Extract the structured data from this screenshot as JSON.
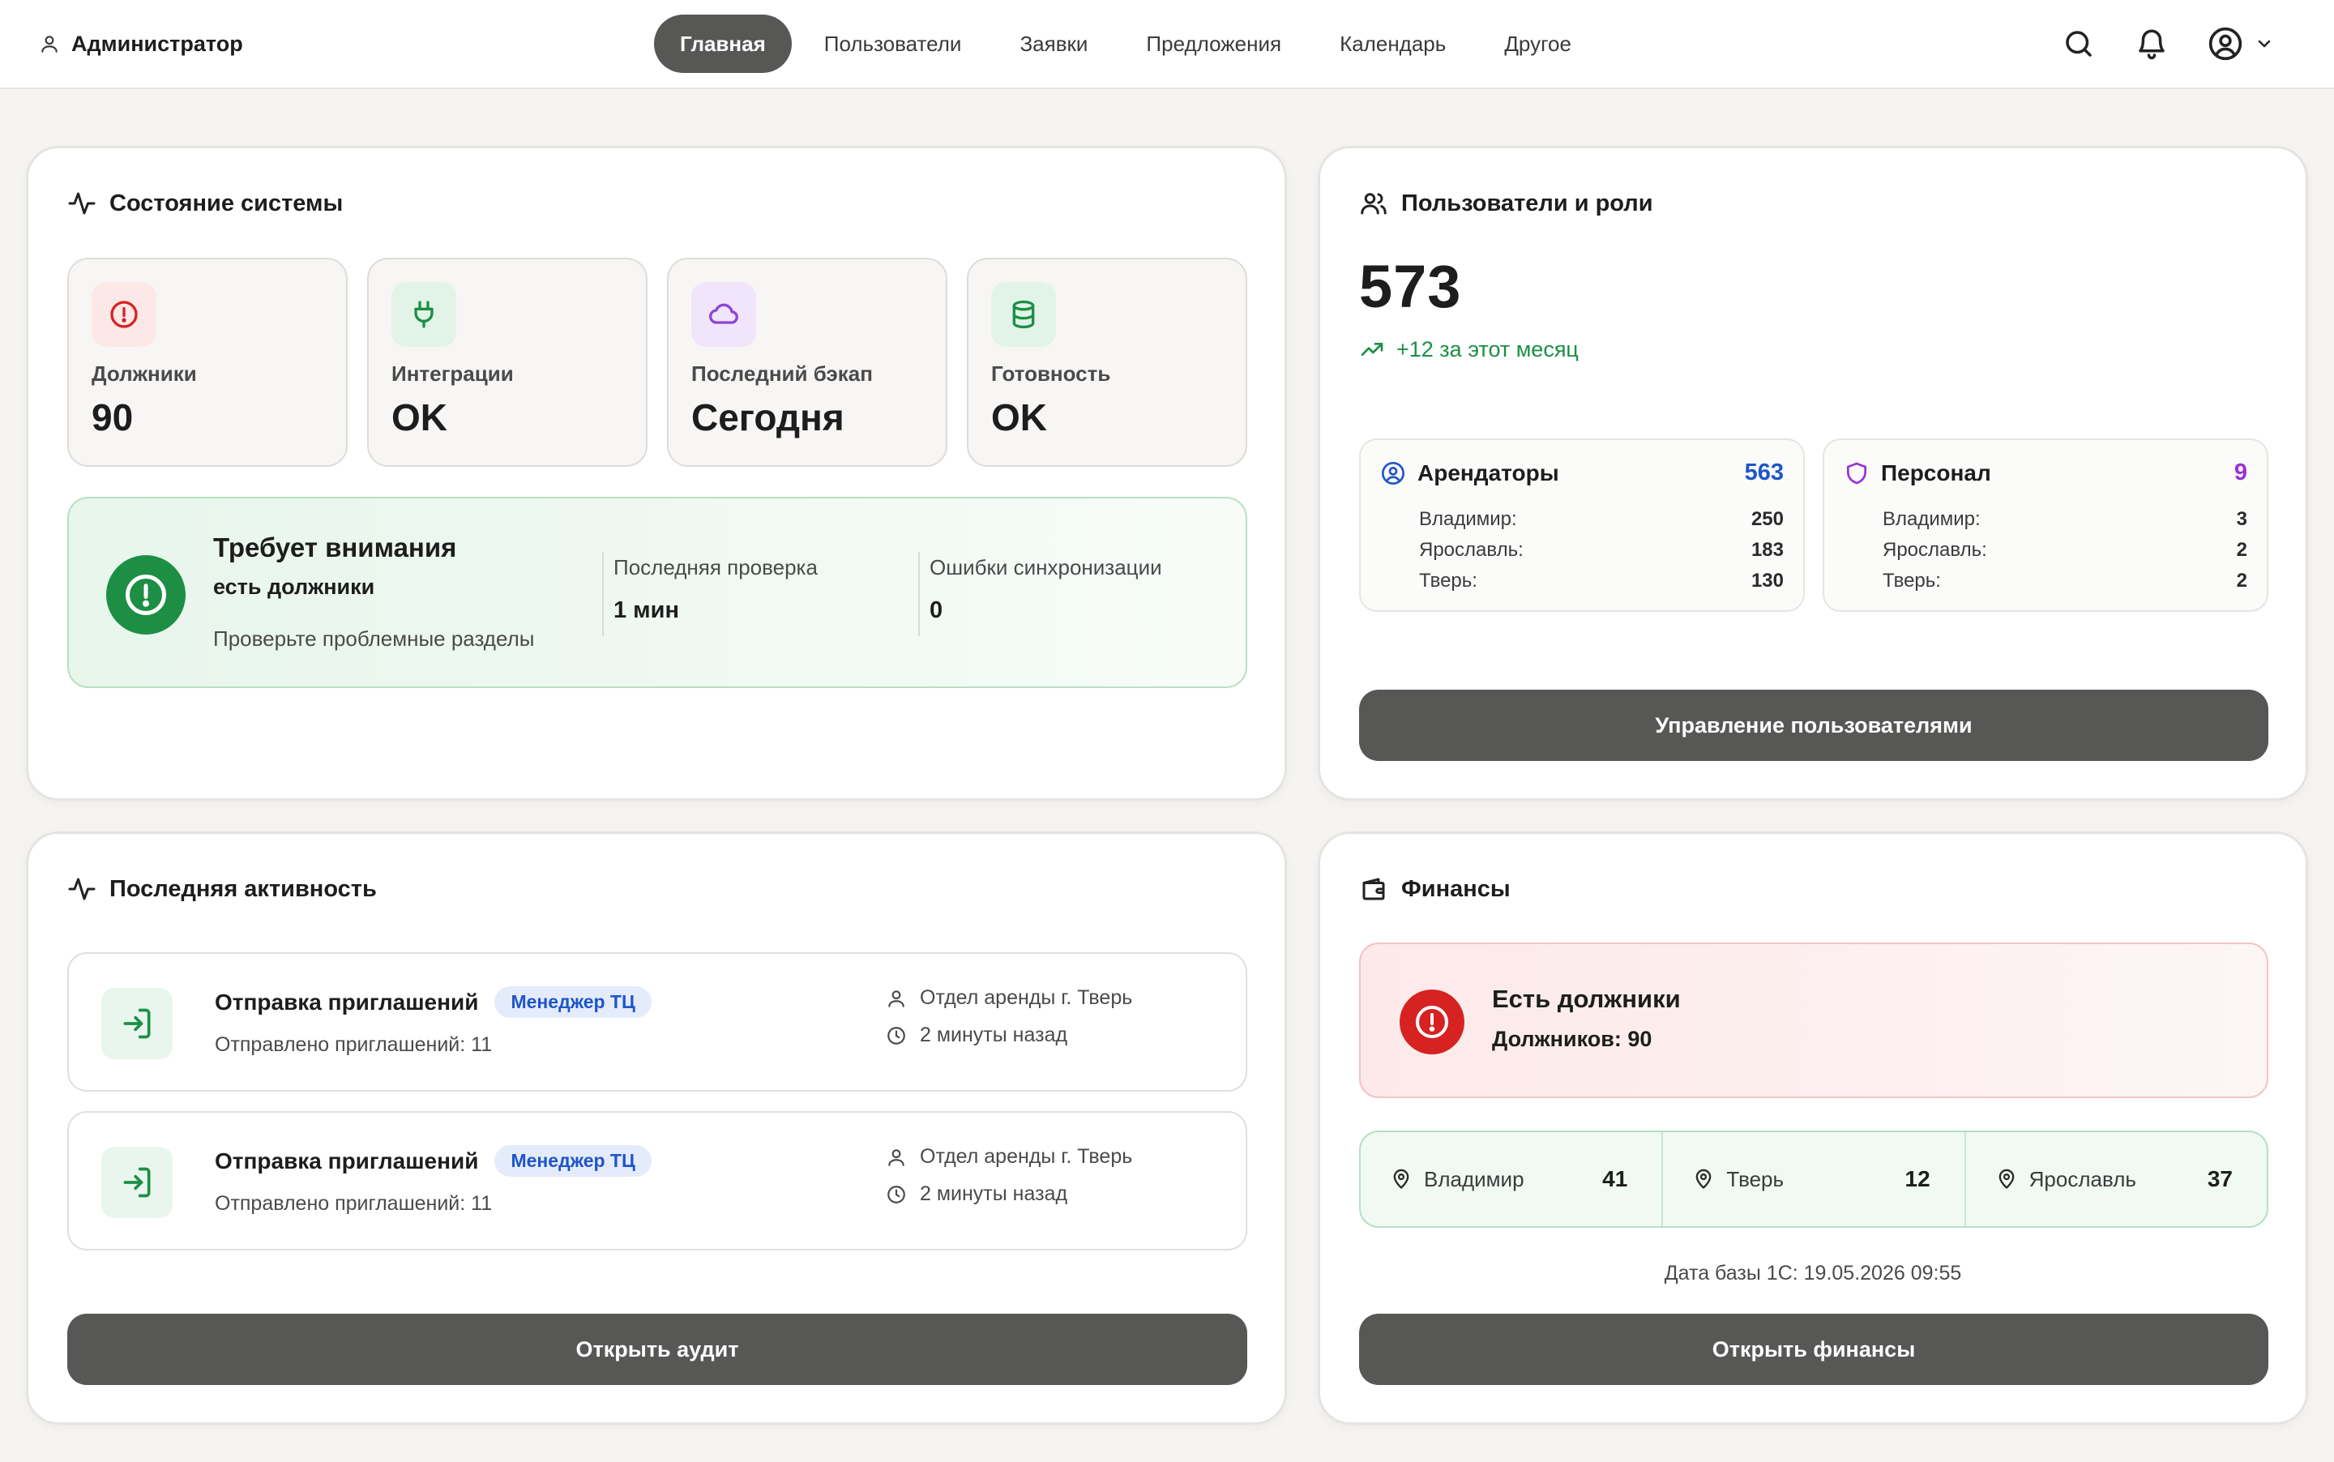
{
  "header": {
    "user_label": "Администратор",
    "nav": [
      {
        "label": "Главная",
        "active": true
      },
      {
        "label": "Пользователи"
      },
      {
        "label": "Заявки"
      },
      {
        "label": "Предложения"
      },
      {
        "label": "Календарь"
      },
      {
        "label": "Другое"
      }
    ],
    "icons": [
      "search-icon",
      "bell-icon",
      "user-circle-icon",
      "chevron-down-icon"
    ]
  },
  "system": {
    "title": "Состояние системы",
    "tiles": [
      {
        "label": "Должники",
        "value": "90",
        "icon": "alert-circle-icon",
        "color": "#d72222"
      },
      {
        "label": "Интеграции",
        "value": "OK",
        "icon": "plug-icon",
        "color": "#1c8f45"
      },
      {
        "label": "Последний бэкап",
        "value": "Сегодня",
        "icon": "cloud-icon",
        "color": "#8e44d6"
      },
      {
        "label": "Готовность",
        "value": "OK",
        "icon": "database-icon",
        "color": "#1c8f45"
      }
    ],
    "attention": {
      "title": "Требует внимания",
      "subtitle": "есть должники",
      "note": "Проверьте проблемные разделы",
      "last_check_label": "Последняя проверка",
      "last_check_value": "1 мин",
      "sync_errors_label": "Ошибки синхронизации",
      "sync_errors_value": "0"
    }
  },
  "users": {
    "title": "Пользователи и роли",
    "total": "573",
    "growth": "+12 за этот месяц",
    "roles": [
      {
        "name": "Арендаторы",
        "count": "563",
        "color": "#1f55c9",
        "icon": "user-circle-icon",
        "rows": [
          {
            "city": "Владимир:",
            "value": "250"
          },
          {
            "city": "Ярославль:",
            "value": "183"
          },
          {
            "city": "Тверь:",
            "value": "130"
          }
        ]
      },
      {
        "name": "Персонал",
        "count": "9",
        "color": "#9b2fd6",
        "icon": "shield-icon",
        "rows": [
          {
            "city": "Владимир:",
            "value": "3"
          },
          {
            "city": "Ярославль:",
            "value": "2"
          },
          {
            "city": "Тверь:",
            "value": "2"
          }
        ]
      }
    ],
    "button": "Управление пользователями"
  },
  "activity": {
    "title": "Последняя активность",
    "items": [
      {
        "title": "Отправка приглашений",
        "badge": "Менеджер ТЦ",
        "subtitle": "Отправлено приглашений: 11",
        "dept": "Отдел аренды г. Тверь",
        "time": "2 минуты назад"
      },
      {
        "title": "Отправка приглашений",
        "badge": "Менеджер ТЦ",
        "subtitle": "Отправлено приглашений: 11",
        "dept": "Отдел аренды г. Тверь",
        "time": "2 минуты назад"
      }
    ],
    "button": "Открыть аудит"
  },
  "finance": {
    "title": "Финансы",
    "alert_title": "Есть должники",
    "alert_sub": "Должников: 90",
    "cities": [
      {
        "name": "Владимир",
        "value": "41"
      },
      {
        "name": "Тверь",
        "value": "12"
      },
      {
        "name": "Ярославль",
        "value": "37"
      }
    ],
    "db_date": "Дата базы 1С: 19.05.2026 09:55",
    "button": "Открыть финансы"
  }
}
